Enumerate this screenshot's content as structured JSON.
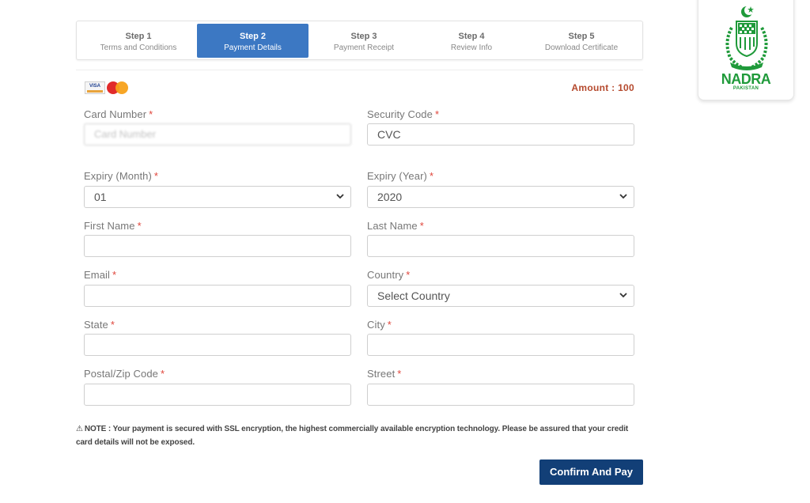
{
  "steps": [
    {
      "title": "Step 1",
      "subtitle": "Terms and Conditions",
      "active": false
    },
    {
      "title": "Step 2",
      "subtitle": "Payment Details",
      "active": true
    },
    {
      "title": "Step 3",
      "subtitle": "Payment Receipt",
      "active": false
    },
    {
      "title": "Step 4",
      "subtitle": "Review Info",
      "active": false
    },
    {
      "title": "Step 5",
      "subtitle": "Download Certificate",
      "active": false
    }
  ],
  "logo": {
    "name": "NADRA",
    "sub": "PAKISTAN",
    "brand_color": "#1f9a3a"
  },
  "payment": {
    "cards": [
      "VISA",
      "MasterCard"
    ],
    "amount_label": "Amount : 100"
  },
  "form": {
    "required_mark": "*",
    "card_number": {
      "label": "Card Number",
      "placeholder": "Card Number"
    },
    "security_code": {
      "label": "Security Code",
      "value": "CVC"
    },
    "expiry_month": {
      "label": "Expiry (Month)",
      "value": "01"
    },
    "expiry_year": {
      "label": "Expiry (Year)",
      "value": "2020"
    },
    "first_name": {
      "label": "First Name",
      "value": ""
    },
    "last_name": {
      "label": "Last Name",
      "value": ""
    },
    "email": {
      "label": "Email",
      "value": ""
    },
    "country": {
      "label": "Country",
      "value": "Select Country"
    },
    "state": {
      "label": "State",
      "value": ""
    },
    "city": {
      "label": "City",
      "value": ""
    },
    "postal_code": {
      "label": "Postal/Zip Code",
      "value": ""
    },
    "street": {
      "label": "Street",
      "value": ""
    }
  },
  "note": "NOTE : Your payment is secured with SSL encryption, the highest commercially available encryption technology. Please be assured that your credit card details will not be exposed.",
  "confirm_label": "Confirm And Pay",
  "colors": {
    "accent": "#3c78c3",
    "primary_button": "#123f77",
    "amount": "#b5492d",
    "required": "#e0463c"
  }
}
